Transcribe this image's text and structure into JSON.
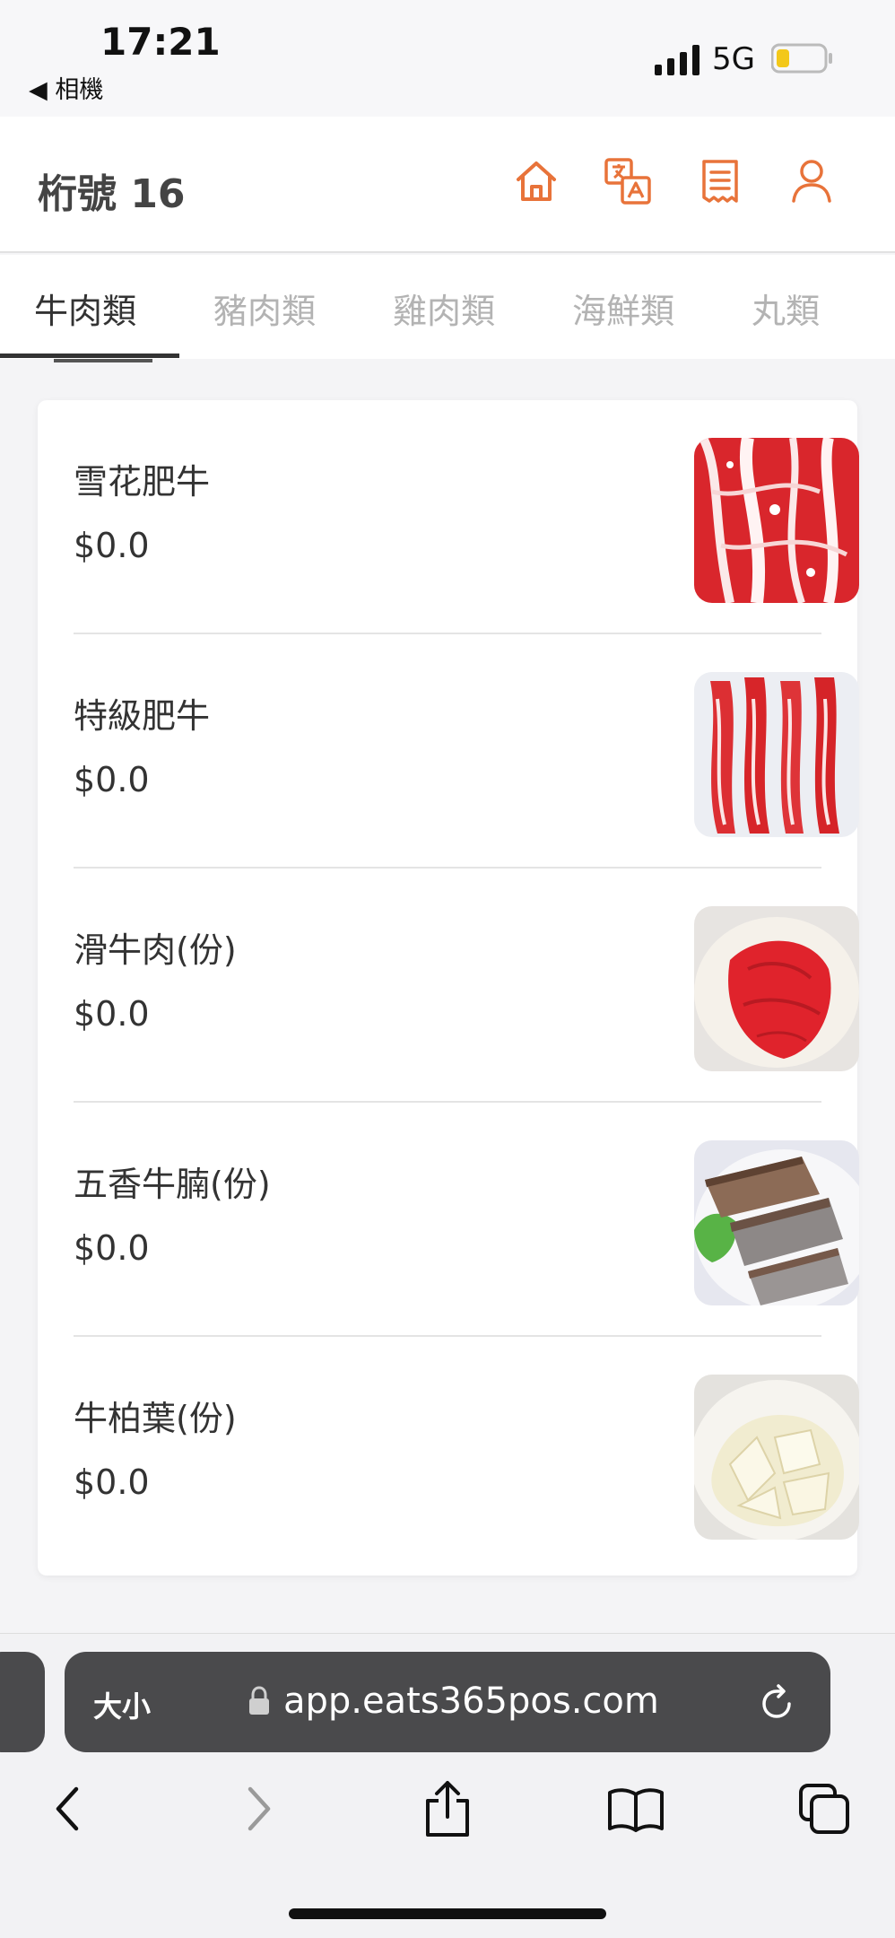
{
  "status": {
    "time": "17:21",
    "back_app": "◀ 相機",
    "network": "5G"
  },
  "header": {
    "title": "桁號 16"
  },
  "tabs": [
    {
      "label": "牛肉類",
      "active": true
    },
    {
      "label": "豬肉類",
      "active": false
    },
    {
      "label": "雞肉類",
      "active": false
    },
    {
      "label": "海鮮類",
      "active": false
    },
    {
      "label": "丸類",
      "active": false
    }
  ],
  "items": [
    {
      "name": "雪花肥牛",
      "price": "$0.0",
      "photo": "marbled-beef-slices"
    },
    {
      "name": "特級肥牛",
      "price": "$0.0",
      "photo": "premium-beef-rolls"
    },
    {
      "name": "滑牛肉(份)",
      "price": "$0.0",
      "photo": "sliced-beef-plate"
    },
    {
      "name": "五香牛腩(份)",
      "price": "$0.0",
      "photo": "spiced-brisket-plate"
    },
    {
      "name": "牛柏葉(份)",
      "price": "$0.0",
      "photo": "beef-tripe-bowl"
    }
  ],
  "browser": {
    "text_size_label": "大小",
    "url": "app.eats365pos.com"
  },
  "colors": {
    "accent": "#e8733a",
    "card": "#ffffff",
    "url_bar": "#4a4a4c"
  }
}
